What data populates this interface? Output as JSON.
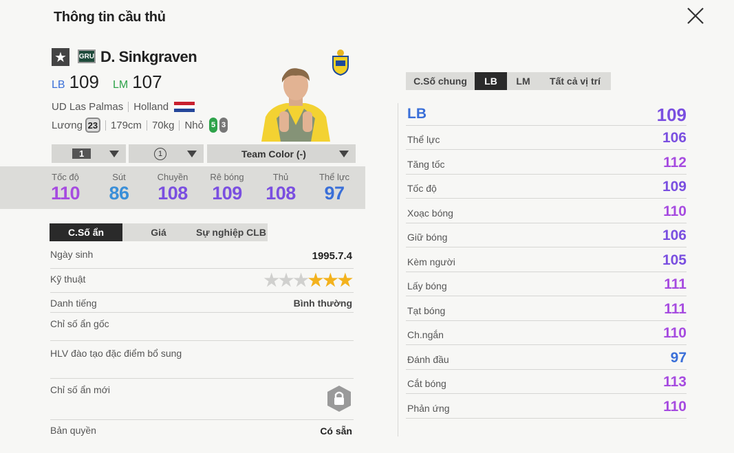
{
  "header": {
    "title": "Thông tin cầu thủ"
  },
  "player": {
    "season_code": "GRU",
    "name": "D. Sinkgraven",
    "positions": [
      {
        "pos": "LB",
        "ovr": "109",
        "color": "#3a6fd8"
      },
      {
        "pos": "LM",
        "ovr": "107",
        "color": "#2ea34a"
      }
    ],
    "club": "UD Las Palmas",
    "nation": "Holland",
    "salary_label": "Lương",
    "salary": "23",
    "height": "179cm",
    "weight": "70kg",
    "build": "Nhỏ",
    "left_foot": "5",
    "right_foot": "3"
  },
  "selectors": {
    "level": "1",
    "grade": "1",
    "team_color": "Team Color (-)"
  },
  "summary_stats": [
    {
      "label": "Tốc độ",
      "value": "110",
      "color": "#a64be0"
    },
    {
      "label": "Sút",
      "value": "86",
      "color": "#3a8fd8"
    },
    {
      "label": "Chuyền",
      "value": "108",
      "color": "#7a4fe0"
    },
    {
      "label": "Rê bóng",
      "value": "109",
      "color": "#7a4fe0"
    },
    {
      "label": "Thủ",
      "value": "108",
      "color": "#7a4fe0"
    },
    {
      "label": "Thể lực",
      "value": "97",
      "color": "#3a6fd8"
    }
  ],
  "left_tabs": [
    "C.Số ẩn",
    "Giá",
    "Sự nghiệp CLB"
  ],
  "details": {
    "birthday_label": "Ngày sinh",
    "birthday": "1995.7.4",
    "skill_label": "Kỹ thuật",
    "skill_stars": 3,
    "fame_label": "Danh tiếng",
    "fame": "Bình thường",
    "hidden_orig_label": "Chỉ số ẩn gốc",
    "coach_label": "HLV đào tạo đặc điểm bổ sung",
    "hidden_new_label": "Chỉ số ẩn mới",
    "license_label": "Bản quyền",
    "license": "Có sẵn"
  },
  "right_tabs": [
    "C.Số chung",
    "LB",
    "LM",
    "Tất cả vị trí"
  ],
  "position_header": {
    "pos": "LB",
    "value": "109"
  },
  "attributes": [
    {
      "label": "Thể lực",
      "value": "106",
      "color": "#7a4fe0"
    },
    {
      "label": "Tăng tốc",
      "value": "112",
      "color": "#a64be0"
    },
    {
      "label": "Tốc độ",
      "value": "109",
      "color": "#7a4fe0"
    },
    {
      "label": "Xoạc bóng",
      "value": "110",
      "color": "#a64be0"
    },
    {
      "label": "Giữ bóng",
      "value": "106",
      "color": "#7a4fe0"
    },
    {
      "label": "Kèm người",
      "value": "105",
      "color": "#7a4fe0"
    },
    {
      "label": "Lấy bóng",
      "value": "111",
      "color": "#a64be0"
    },
    {
      "label": "Tạt bóng",
      "value": "111",
      "color": "#a64be0"
    },
    {
      "label": "Ch.ngắn",
      "value": "110",
      "color": "#a64be0"
    },
    {
      "label": "Đánh đầu",
      "value": "97",
      "color": "#3a6fd8"
    },
    {
      "label": "Cắt bóng",
      "value": "113",
      "color": "#a64be0"
    },
    {
      "label": "Phản ứng",
      "value": "110",
      "color": "#a64be0"
    }
  ]
}
